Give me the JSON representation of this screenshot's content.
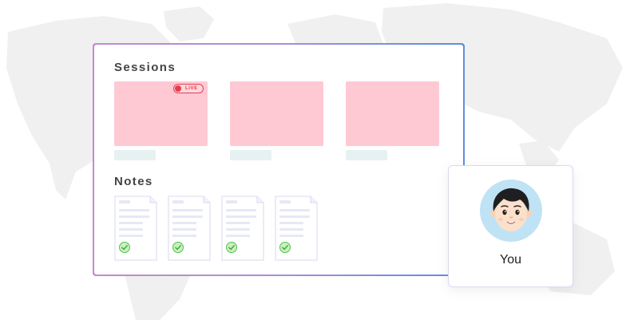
{
  "sessions": {
    "title": "Sessions",
    "items": [
      {
        "live": true,
        "live_label": "LIVE"
      },
      {
        "live": false
      },
      {
        "live": false
      }
    ]
  },
  "notes": {
    "title": "Notes",
    "count": 4,
    "status_icon": "check-circle-icon"
  },
  "profile": {
    "name": "You",
    "avatar_icon": "avatar-icon"
  },
  "colors": {
    "session_thumbnail": "#ffc9d4",
    "live": "#e23d4e",
    "check": "#55c24f",
    "avatar_background": "#bfe3f5"
  }
}
